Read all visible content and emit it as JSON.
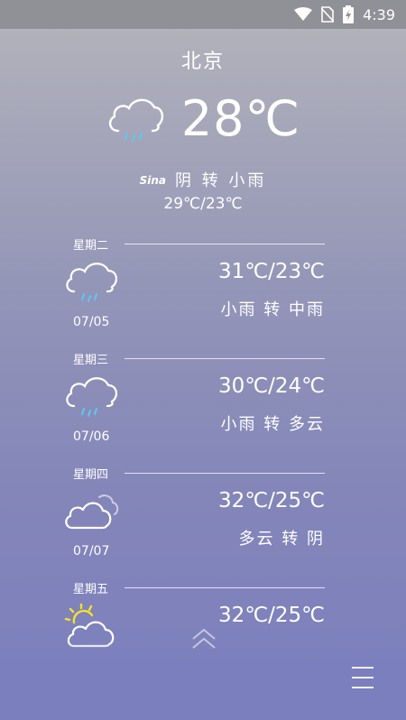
{
  "status_bar": {
    "time": "4:39",
    "icons": [
      "wifi-icon",
      "no-sim-icon",
      "battery-charging-icon"
    ]
  },
  "city": "北京",
  "current": {
    "temperature": "28℃",
    "icon": "cloud-rain-icon",
    "source_logo": "Sina",
    "condition": "阴 转 小雨",
    "range": "29℃/23℃"
  },
  "forecast": [
    {
      "weekday": "星期二",
      "date": "07/05",
      "temp": "31℃/23℃",
      "condition": "小雨 转 中雨",
      "icon": "cloud-rain-icon"
    },
    {
      "weekday": "星期三",
      "date": "07/06",
      "temp": "30℃/24℃",
      "condition": "小雨 转 多云",
      "icon": "cloud-rain-icon"
    },
    {
      "weekday": "星期四",
      "date": "07/07",
      "temp": "32℃/25℃",
      "condition": "多云 转 阴",
      "icon": "cloudy-icon"
    },
    {
      "weekday": "星期五",
      "date": "",
      "temp": "32℃/25℃",
      "condition": "",
      "icon": "partly-sunny-icon"
    }
  ],
  "controls": {
    "expand_icon": "double-chevron-up-icon",
    "menu_icon": "hamburger-menu-icon"
  },
  "colors": {
    "rain_drop": "#5fc8f0",
    "sun": "#f4e22a"
  }
}
